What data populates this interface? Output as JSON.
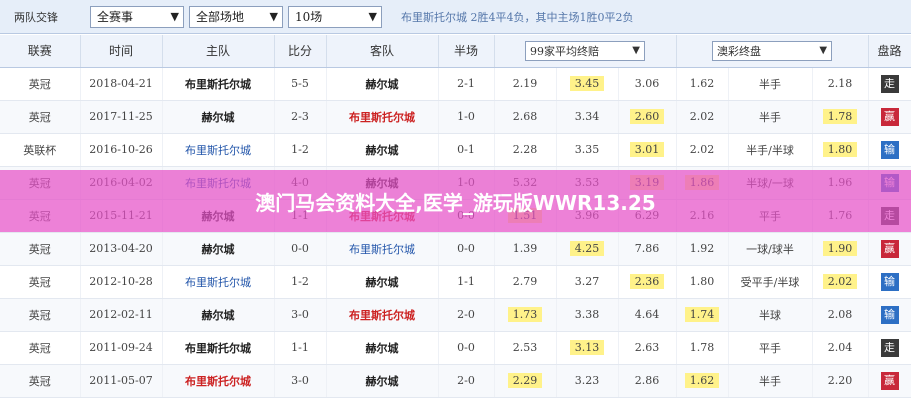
{
  "toolbar": {
    "label": "两队交锋",
    "competition": "全赛事",
    "venue": "全部场地",
    "count": "10场",
    "summary": "布里斯托尔城 2胜4平4负，其中主场1胜0平2负"
  },
  "headers": {
    "league": "联赛",
    "date": "时间",
    "home": "主队",
    "score": "比分",
    "away": "客队",
    "half": "半场",
    "odds_select": "99家平均终赔",
    "ah_select": "澳彩终盘",
    "result": "盘路"
  },
  "rows": [
    {
      "league": "英冠",
      "date": "2018-04-21",
      "home": "布里斯托尔城",
      "score": "5-5",
      "away": "赫尔城",
      "half": "2-1",
      "o1": "2.19",
      "o2": "3.45",
      "o3": "3.06",
      "a1": "1.62",
      "line": "半手",
      "a2": "2.18",
      "result": "走"
    },
    {
      "league": "英冠",
      "date": "2017-11-25",
      "home": "赫尔城",
      "score": "2-3",
      "away": "布里斯托尔城",
      "half": "1-0",
      "o1": "2.68",
      "o2": "3.34",
      "o3": "2.60",
      "a1": "2.02",
      "line": "半手",
      "a2": "1.78",
      "result": "赢"
    },
    {
      "league": "英联杯",
      "date": "2016-10-26",
      "home": "布里斯托尔城",
      "score": "1-2",
      "away": "赫尔城",
      "half": "0-1",
      "o1": "2.28",
      "o2": "3.35",
      "o3": "3.01",
      "a1": "2.02",
      "line": "半手/半球",
      "a2": "1.80",
      "result": "输"
    },
    {
      "league": "英冠",
      "date": "2016-04-02",
      "home": "布里斯托尔城",
      "score": "4-0",
      "away": "赫尔城",
      "half": "1-0",
      "o1": "5.32",
      "o2": "3.53",
      "o3": "3.19",
      "a1": "1.86",
      "line": "半球/一球",
      "a2": "1.96",
      "result": "输"
    },
    {
      "league": "英冠",
      "date": "2015-11-21",
      "home": "赫尔城",
      "score": "1-1",
      "away": "布里斯托尔城",
      "half": "0-0",
      "o1": "1.51",
      "o2": "3.96",
      "o3": "6.29",
      "a1": "2.16",
      "line": "平手",
      "a2": "1.76",
      "result": "走"
    },
    {
      "league": "英冠",
      "date": "2013-04-20",
      "home": "赫尔城",
      "score": "0-0",
      "away": "布里斯托尔城",
      "half": "0-0",
      "o1": "1.39",
      "o2": "4.25",
      "o3": "7.86",
      "a1": "1.92",
      "line": "一球/球半",
      "a2": "1.90",
      "result": "赢"
    },
    {
      "league": "英冠",
      "date": "2012-10-28",
      "home": "布里斯托尔城",
      "score": "1-2",
      "away": "赫尔城",
      "half": "1-1",
      "o1": "2.79",
      "o2": "3.27",
      "o3": "2.36",
      "a1": "1.80",
      "line": "受平手/半球",
      "a2": "2.02",
      "result": "输"
    },
    {
      "league": "英冠",
      "date": "2012-02-11",
      "home": "赫尔城",
      "score": "3-0",
      "away": "布里斯托尔城",
      "half": "2-0",
      "o1": "1.73",
      "o2": "3.38",
      "o3": "4.64",
      "a1": "1.74",
      "line": "半球",
      "a2": "2.08",
      "result": "输"
    },
    {
      "league": "英冠",
      "date": "2011-09-24",
      "home": "布里斯托尔城",
      "score": "1-1",
      "away": "赫尔城",
      "half": "0-0",
      "o1": "2.53",
      "o2": "3.13",
      "o3": "2.63",
      "a1": "1.78",
      "line": "平手",
      "a2": "2.04",
      "result": "走"
    },
    {
      "league": "英冠",
      "date": "2011-05-07",
      "home": "布里斯托尔城",
      "score": "3-0",
      "away": "赫尔城",
      "half": "2-0",
      "o1": "2.29",
      "o2": "3.23",
      "o3": "2.86",
      "a1": "1.62",
      "line": "半手",
      "a2": "2.20",
      "result": "赢"
    }
  ],
  "watermark": "澳门马会资料大全,医学_游玩版WWR13.25"
}
